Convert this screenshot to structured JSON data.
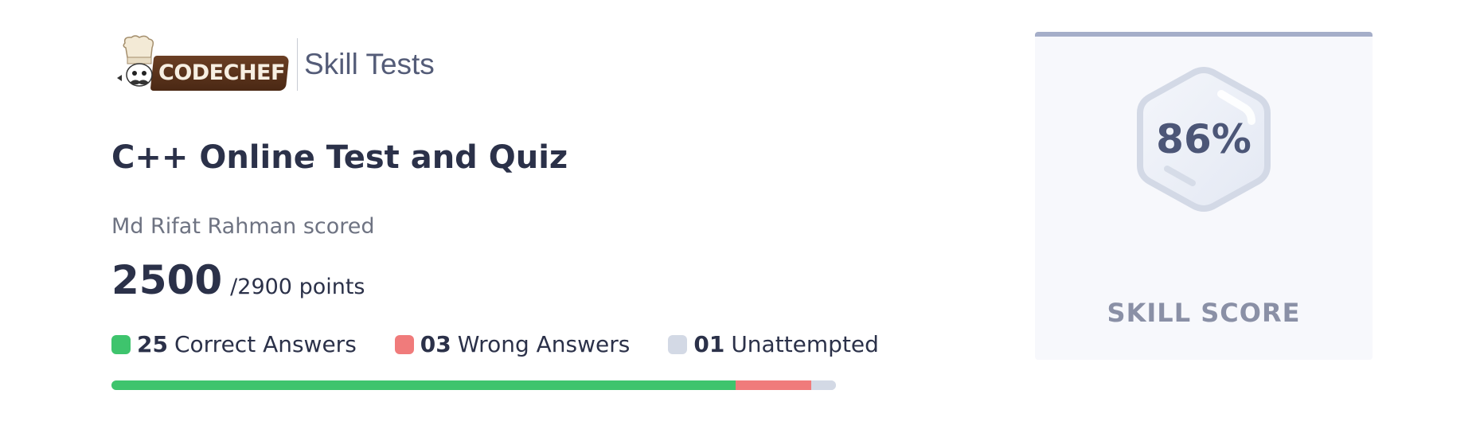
{
  "header": {
    "logo_text": "CODECHEF",
    "subtitle": "Skill Tests"
  },
  "test": {
    "title": "C++ Online Test and Quiz",
    "scored_by": "Md Rifat Rahman scored",
    "score": "2500",
    "total": "/2900 points"
  },
  "legend": [
    {
      "count": "25",
      "label": "Correct Answers",
      "color": "#3ec46d"
    },
    {
      "count": "03",
      "label": "Wrong Answers",
      "color": "#f07b7b"
    },
    {
      "count": "01",
      "label": "Unattempted",
      "color": "#d3d9e5"
    }
  ],
  "progress": {
    "correct_fraction": 0.862,
    "wrong_fraction": 0.104,
    "unattempted_fraction": 0.034
  },
  "skill_card": {
    "percent": "86%",
    "label": "SKILL SCORE"
  }
}
